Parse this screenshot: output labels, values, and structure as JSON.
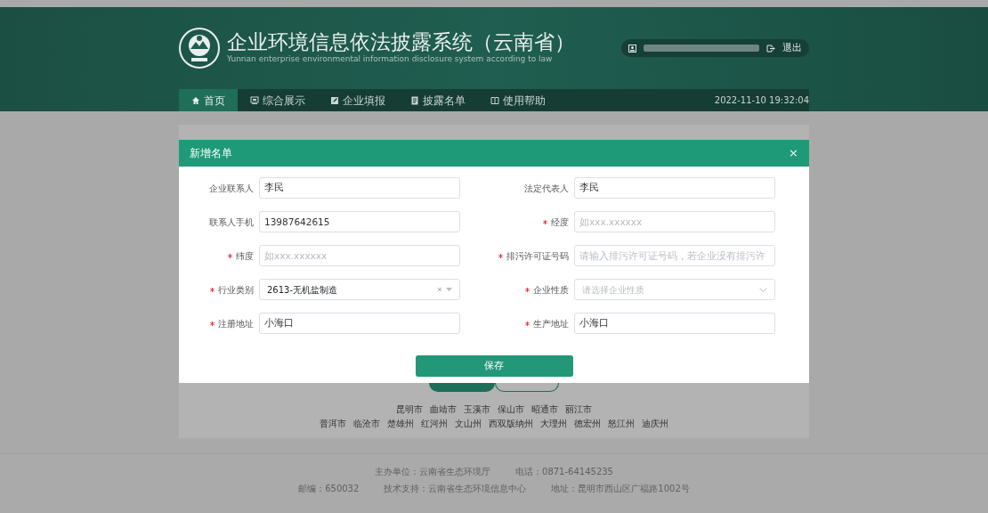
{
  "header": {
    "title": "企业环境信息依法披露系统（云南省）",
    "subtitle": "Yunnan enterprise environmental information disclosure system according to law",
    "logout": "退出",
    "datetime": "2022-11-10 19:32:04"
  },
  "nav": [
    {
      "label": "首页",
      "selected": true
    },
    {
      "label": "综合展示",
      "selected": false
    },
    {
      "label": "企业填报",
      "selected": false
    },
    {
      "label": "披露名单",
      "selected": false
    },
    {
      "label": "使用帮助",
      "selected": false
    }
  ],
  "regions": {
    "row_1": [
      "昆明市",
      "曲靖市",
      "玉溪市",
      "保山市",
      "昭通市",
      "丽江市"
    ],
    "row_2": [
      "普洱市",
      "临沧市",
      "楚雄州",
      "红河州",
      "文山州",
      "西双版纳州",
      "大理州",
      "德宏州",
      "怒江州",
      "迪庆州"
    ]
  },
  "footer": {
    "line_1": [
      "主办单位：云南省生态环境厅",
      "电话：0871-64145235"
    ],
    "line_2": [
      "邮编：650032",
      "技术支持：云南省生态环境信息中心",
      "地址：昆明市西山区广福路1002号"
    ]
  },
  "modal": {
    "title": "新增名单",
    "close": "×",
    "save": "保存",
    "fields": [
      {
        "kind": "text",
        "label": "企业联系人",
        "required": false,
        "value": "李民"
      },
      {
        "kind": "text",
        "label": "法定代表人",
        "required": false,
        "value": "李民"
      },
      {
        "kind": "text",
        "label": "联系人手机",
        "required": false,
        "value": "13987642615"
      },
      {
        "kind": "text",
        "label": "经度",
        "required": true,
        "placeholder": "如xxx.xxxxxx"
      },
      {
        "kind": "text",
        "label": "纬度",
        "required": true,
        "placeholder": "如xxx.xxxxxx"
      },
      {
        "kind": "text",
        "label": "排污许可证号码",
        "required": true,
        "placeholder": "请输入排污许可证号码，若企业没有排污许"
      },
      {
        "kind": "select",
        "label": "行业类别",
        "required": true,
        "value": "2613-无机盐制造",
        "clearable": true
      },
      {
        "kind": "select",
        "label": "企业性质",
        "required": true,
        "placeholder": "请选择企业性质",
        "clearable": false
      },
      {
        "kind": "text",
        "label": "注册地址",
        "required": true,
        "value": "小海口"
      },
      {
        "kind": "text",
        "label": "生产地址",
        "required": true,
        "value": "小海口"
      }
    ]
  }
}
